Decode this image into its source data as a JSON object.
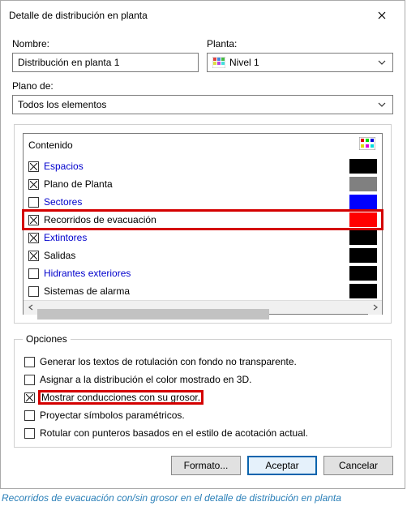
{
  "window": {
    "title": "Detalle de distribución en planta"
  },
  "labels": {
    "nombre": "Nombre:",
    "planta": "Planta:",
    "plano_de": "Plano de:",
    "contenido": "Contenido",
    "opciones": "Opciones"
  },
  "fields": {
    "nombre_value": "Distribución en planta 1",
    "planta_value": "Nivel 1",
    "plano_value": "Todos los elementos"
  },
  "content_items": [
    {
      "label": "Espacios",
      "checked": true,
      "link": true,
      "color": "#000000"
    },
    {
      "label": "Plano de Planta",
      "checked": true,
      "link": false,
      "color": "#808080"
    },
    {
      "label": "Sectores",
      "checked": false,
      "link": true,
      "color": "#0000ff"
    },
    {
      "label": "Recorridos de evacuación",
      "checked": true,
      "link": false,
      "color": "#ff0000",
      "highlight": true
    },
    {
      "label": "Extintores",
      "checked": true,
      "link": true,
      "color": "#000000"
    },
    {
      "label": "Salidas",
      "checked": true,
      "link": false,
      "color": "#000000"
    },
    {
      "label": "Hidrantes exteriores",
      "checked": false,
      "link": true,
      "color": "#000000"
    },
    {
      "label": "Sistemas de alarma",
      "checked": false,
      "link": false,
      "color": "#000000"
    }
  ],
  "options": [
    {
      "label": "Generar los textos de rotulación con fondo no transparente.",
      "checked": false
    },
    {
      "label": "Asignar a la distribución el color mostrado en 3D.",
      "checked": false
    },
    {
      "label": "Mostrar conducciones con su grosor.",
      "checked": true,
      "highlight": true
    },
    {
      "label": "Proyectar símbolos paramétricos.",
      "checked": false
    },
    {
      "label": "Rotular con punteros basados en el estilo de acotación actual.",
      "checked": false
    }
  ],
  "buttons": {
    "formato": "Formato...",
    "aceptar": "Aceptar",
    "cancelar": "Cancelar"
  },
  "caption": "Recorridos de evacuación con/sin grosor en el detalle de distribución en planta"
}
